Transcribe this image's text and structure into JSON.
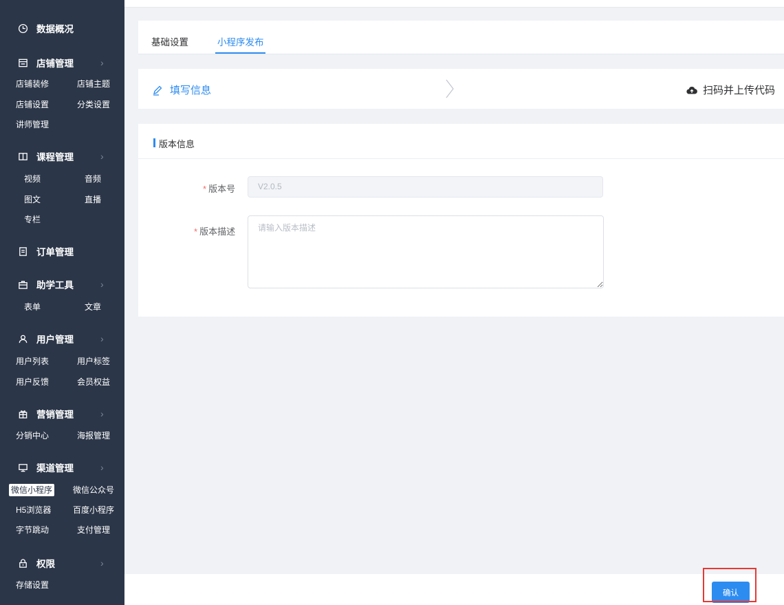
{
  "sidebar": {
    "groups": [
      {
        "label": "数据概况",
        "icon": "clock-icon",
        "has_arrow": false,
        "items": []
      },
      {
        "label": "店铺管理",
        "icon": "shop-icon",
        "has_arrow": true,
        "items": [
          "店铺装修",
          "店铺主题",
          "店铺设置",
          "分类设置",
          "讲师管理"
        ]
      },
      {
        "label": "课程管理",
        "icon": "book-icon",
        "has_arrow": true,
        "items": [
          "视频",
          "音频",
          "图文",
          "直播",
          "专栏"
        ]
      },
      {
        "label": "订单管理",
        "icon": "list-icon",
        "has_arrow": false,
        "items": []
      },
      {
        "label": "助学工具",
        "icon": "briefcase-icon",
        "has_arrow": true,
        "items": [
          "表单",
          "文章"
        ]
      },
      {
        "label": "用户管理",
        "icon": "user-icon",
        "has_arrow": true,
        "items": [
          "用户列表",
          "用户标签",
          "用户反馈",
          "会员权益"
        ]
      },
      {
        "label": "营销管理",
        "icon": "gift-icon",
        "has_arrow": true,
        "items": [
          "分销中心",
          "海报管理"
        ]
      },
      {
        "label": "渠道管理",
        "icon": "monitor-icon",
        "has_arrow": true,
        "items": [
          "微信小程序",
          "微信公众号",
          "H5浏览器",
          "百度小程序",
          "字节跳动",
          "支付管理"
        ]
      },
      {
        "label": "权限",
        "icon": "lock-icon",
        "has_arrow": true,
        "items": [
          "存储设置"
        ]
      }
    ],
    "arrow_glyph": "›",
    "active_item": "微信小程序"
  },
  "tabs": [
    {
      "label": "基础设置"
    },
    {
      "label": "小程序发布"
    }
  ],
  "active_tab": "小程序发布",
  "steps": {
    "step1": "填写信息",
    "step2": "扫码并上传代码"
  },
  "form": {
    "section_title": "版本信息",
    "required_mark": "*",
    "version_label": "版本号",
    "version_value": "V2.0.5",
    "desc_label": "版本描述",
    "desc_placeholder": "请输入版本描述",
    "desc_value": ""
  },
  "footer": {
    "confirm_label": "确认"
  },
  "colors": {
    "sidebar_bg": "#2b3648",
    "accent": "#2d8cf0",
    "required": "#f56c6c",
    "highlight": "#e53935"
  }
}
